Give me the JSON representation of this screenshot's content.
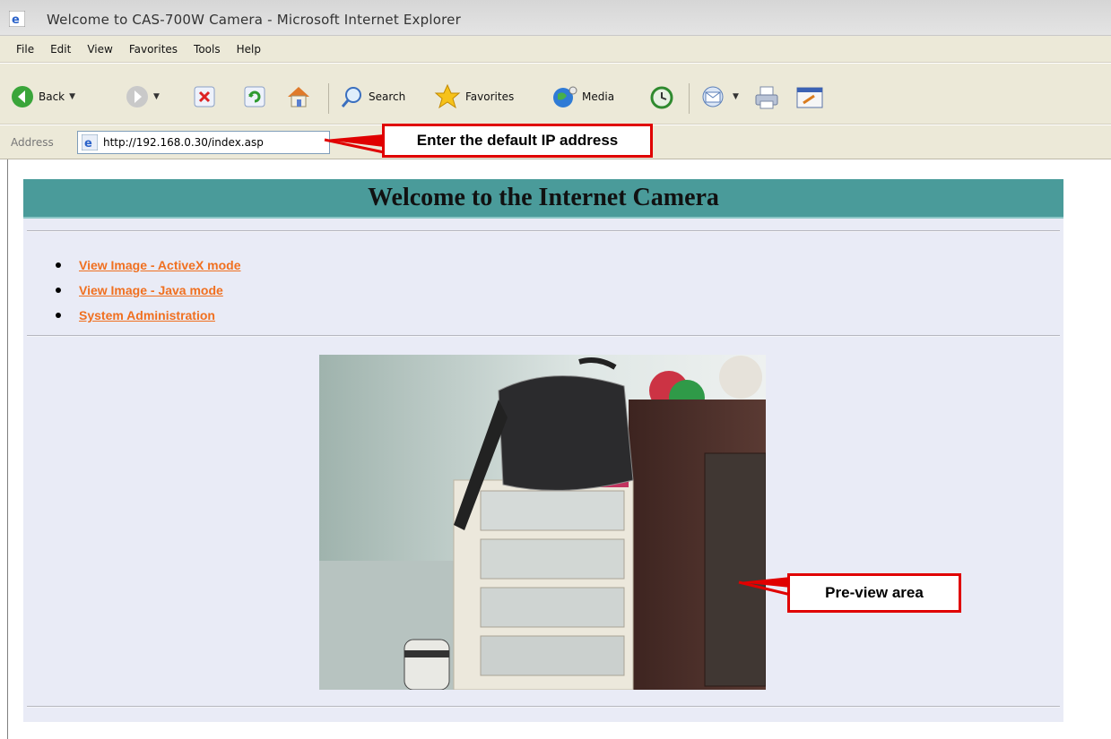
{
  "window": {
    "title": "Welcome to CAS-700W Camera - Microsoft Internet Explorer"
  },
  "menu": [
    "File",
    "Edit",
    "View",
    "Favorites",
    "Tools",
    "Help"
  ],
  "toolbar": {
    "back": "Back",
    "search": "Search",
    "favorites": "Favorites",
    "media": "Media"
  },
  "address": {
    "label": "Address",
    "url": "http://192.168.0.30/index.asp"
  },
  "callouts": {
    "ip": "Enter the default IP address",
    "preview": "Pre-view area"
  },
  "page": {
    "heading": "Welcome to the Internet Camera",
    "links": [
      "View Image - ActiveX mode",
      "View Image - Java mode",
      "System Administration"
    ]
  },
  "colors": {
    "header_bg": "#4a9b9a",
    "panel_bg": "#e9ebf6",
    "link": "#f07020",
    "callout_border": "#e00000"
  }
}
